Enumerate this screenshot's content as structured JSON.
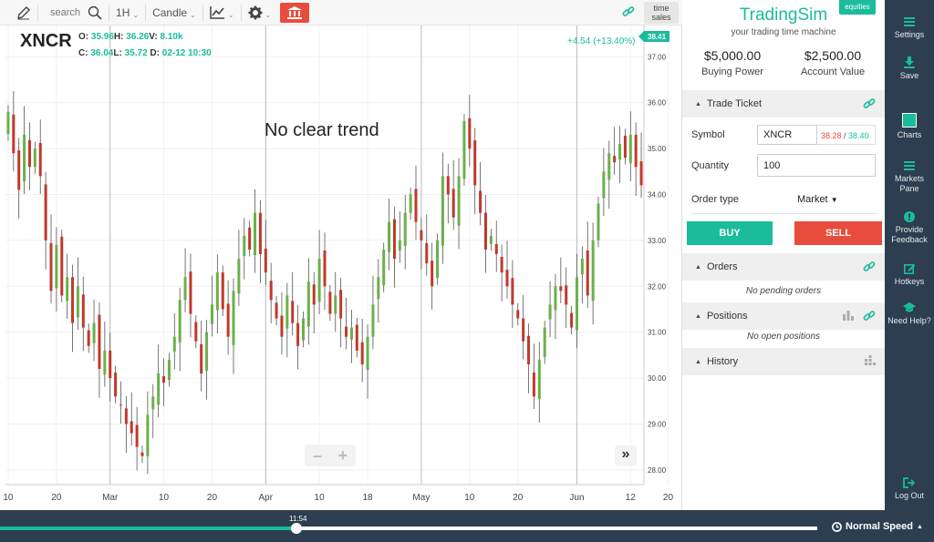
{
  "toolbar": {
    "search_label": "search",
    "interval": "1H",
    "chart_style": "Candle",
    "time_sales_label": "time sales"
  },
  "ohlc": {
    "ticker": "XNCR",
    "o_label": "O:",
    "o": "35.96",
    "h_label": "H:",
    "h": "36.26",
    "v_label": "V:",
    "v": "8.10k",
    "c_label": "C:",
    "c": "36.04",
    "l_label": "L:",
    "l": "35.72",
    "d_label": "D:",
    "d": "02-12 10:30"
  },
  "change_label": "+4.54 (+13.40%)",
  "annotation": "No clear trend",
  "chart_data": {
    "type": "candlestick",
    "symbol": "XNCR",
    "last_price": "38.41",
    "y_ticks": [
      "37.00",
      "36.00",
      "35.00",
      "34.00",
      "33.00",
      "32.00",
      "31.00",
      "30.00",
      "29.00",
      "28.00"
    ],
    "ylim": [
      27.68,
      37.68
    ],
    "x_ticks": [
      "10",
      "20",
      "Mar",
      "10",
      "20",
      "Apr",
      "10",
      "18",
      "May",
      "10",
      "20",
      "Jun",
      "12",
      "20"
    ],
    "x_tick_indices": [
      0,
      9,
      19,
      29,
      38,
      48,
      58,
      67,
      77,
      86,
      95,
      106,
      116,
      123
    ],
    "month_separators": [
      19,
      48,
      77,
      106
    ],
    "series": [
      {
        "name": "price",
        "values": [
          35.8,
          34.9,
          34.1,
          35.3,
          34.6,
          35.0,
          34.4,
          33.0,
          31.9,
          32.9,
          31.8,
          32.2,
          31.2,
          32.0,
          31.1,
          30.7,
          31.2,
          30.2,
          30.6,
          30.0,
          29.6,
          29.4,
          29.0,
          28.8,
          28.5,
          28.3,
          29.2,
          29.6,
          30.1,
          29.9,
          30.4,
          30.9,
          31.7,
          32.2,
          31.4,
          30.8,
          30.1,
          31.0,
          31.6,
          32.3,
          31.5,
          30.9,
          31.9,
          32.6,
          33.1,
          32.8,
          33.6,
          32.7,
          32.3,
          31.7,
          31.3,
          30.9,
          31.8,
          31.2,
          30.7,
          31.3,
          32.1,
          31.6,
          32.6,
          32.0,
          31.4,
          31.8,
          31.3,
          30.9,
          31.1,
          30.6,
          30.3,
          30.9,
          31.6,
          32.2,
          32.8,
          33.4,
          32.6,
          33.0,
          33.6,
          34.0,
          33.4,
          33.0,
          32.5,
          32.0,
          33.0,
          34.4,
          34.0,
          33.5,
          34.4,
          35.6,
          35.0,
          34.2,
          33.6,
          32.8,
          33.1,
          32.7,
          32.3,
          32.0,
          31.6,
          31.3,
          30.8,
          30.3,
          29.6,
          30.4,
          31.1,
          31.6,
          32.0,
          31.9,
          31.6,
          31.1,
          32.2,
          32.6,
          31.8,
          33.0,
          33.8,
          34.5,
          34.9,
          34.7,
          35.1,
          34.8,
          35.3,
          34.6,
          34.2
        ]
      }
    ]
  }
}
